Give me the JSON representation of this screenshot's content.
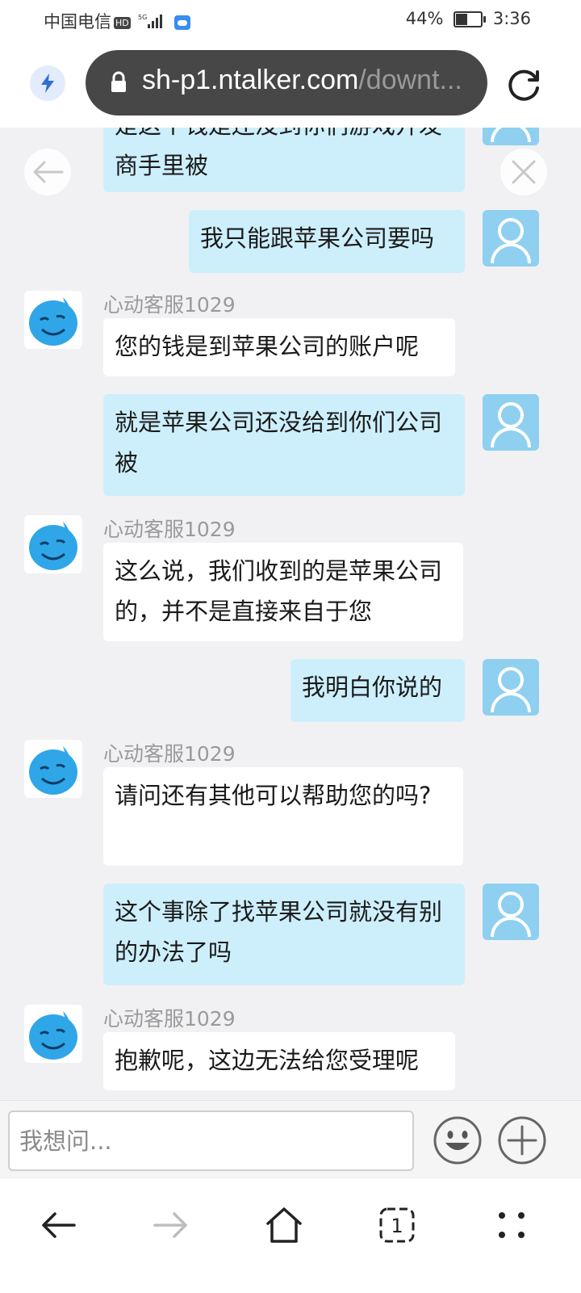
{
  "status_bar": {
    "carrier": "中国电信",
    "badge": "HD",
    "network": "5G",
    "battery": "44%",
    "battery_level": 0.44,
    "time": "3:36"
  },
  "browser": {
    "url_host": "sh-p1.ntalker.com",
    "url_path": "/downt..."
  },
  "chat": {
    "messages": [
      {
        "from": "user",
        "text": "就是苹果公司还没给到你们公司被"
      },
      {
        "from": "user",
        "text": "是这个钱是还没到你们游戏开发商手里被"
      },
      {
        "from": "user",
        "text": "我只能跟苹果公司要吗"
      },
      {
        "from": "agent",
        "name": "心动客服1029",
        "text": "您的钱是到苹果公司的账户呢"
      },
      {
        "from": "user",
        "text": "就是苹果公司还没给到你们公司被"
      },
      {
        "from": "agent",
        "name": "心动客服1029",
        "text": "这么说，我们收到的是苹果公司的，并不是直接来自于您"
      },
      {
        "from": "user",
        "text": "我明白你说的"
      },
      {
        "from": "agent",
        "name": "心动客服1029",
        "text": "请问还有其他可以帮助您的吗?"
      },
      {
        "from": "user",
        "text": "这个事除了找苹果公司就没有别的办法了吗"
      },
      {
        "from": "agent",
        "name": "心动客服1029",
        "text": "抱歉呢，这边无法给您受理呢"
      }
    ]
  },
  "input": {
    "placeholder": "我想问..."
  },
  "icons": {
    "lightning": "lightning-icon",
    "lock": "lock-icon",
    "refresh": "refresh-icon",
    "back": "back-arrow-icon",
    "close": "close-icon",
    "emoji": "emoji-icon",
    "plus": "plus-icon",
    "nav_back": "nav-back-icon",
    "nav_forward": "nav-forward-icon",
    "home": "home-icon",
    "tabs": "tabs-icon",
    "more": "more-icon"
  },
  "bottom_nav": {
    "tabs_count": "1"
  },
  "colors": {
    "user_bubble": "#cdeffc",
    "agent_bubble": "#ffffff",
    "chat_background": "#f1f1f4",
    "accent": "#2f6fd8"
  }
}
